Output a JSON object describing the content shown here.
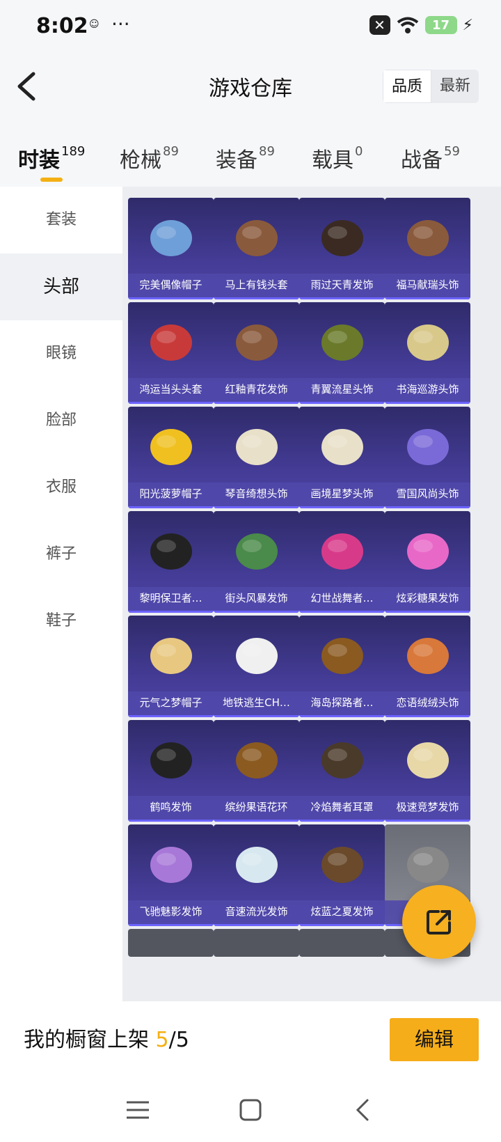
{
  "status": {
    "time": "8:02",
    "battery": "17"
  },
  "header": {
    "title": "游戏仓库",
    "sort_quality": "品质",
    "sort_newest": "最新"
  },
  "tabs": [
    {
      "label": "时装",
      "count": "189"
    },
    {
      "label": "枪械",
      "count": "89"
    },
    {
      "label": "装备",
      "count": "89"
    },
    {
      "label": "载具",
      "count": "0"
    },
    {
      "label": "战备",
      "count": "59"
    }
  ],
  "side": [
    "套装",
    "头部",
    "眼镜",
    "脸部",
    "衣服",
    "裤子",
    "鞋子"
  ],
  "items": [
    "完美偶像帽子",
    "马上有钱头套",
    "雨过天青发饰",
    "福马献瑞头饰",
    "鸿运当头头套",
    "红釉青花发饰",
    "青翼流星头饰",
    "书海巡游头饰",
    "阳光菠萝帽子",
    "琴音绮想头饰",
    "画境星梦头饰",
    "雪国风尚头饰",
    "黎明保卫者…",
    "街头风暴发饰",
    "幻世战舞者…",
    "炫彩糖果发饰",
    "元气之梦帽子",
    "地铁逃生CH…",
    "海岛探路者…",
    "恋语绒绒头饰",
    "鹤鸣发饰",
    "缤纷果语花环",
    "冷焰舞者耳罩",
    "极速竞梦发饰",
    "飞驰魅影发饰",
    "音速流光发饰",
    "炫蓝之夏发饰",
    "…"
  ],
  "bottom": {
    "prefix": "我的橱窗上架 ",
    "current": "5",
    "suffix": "/5",
    "edit": "编辑"
  },
  "colors": {
    "accent": "#f4b013",
    "card": "#433b94"
  }
}
